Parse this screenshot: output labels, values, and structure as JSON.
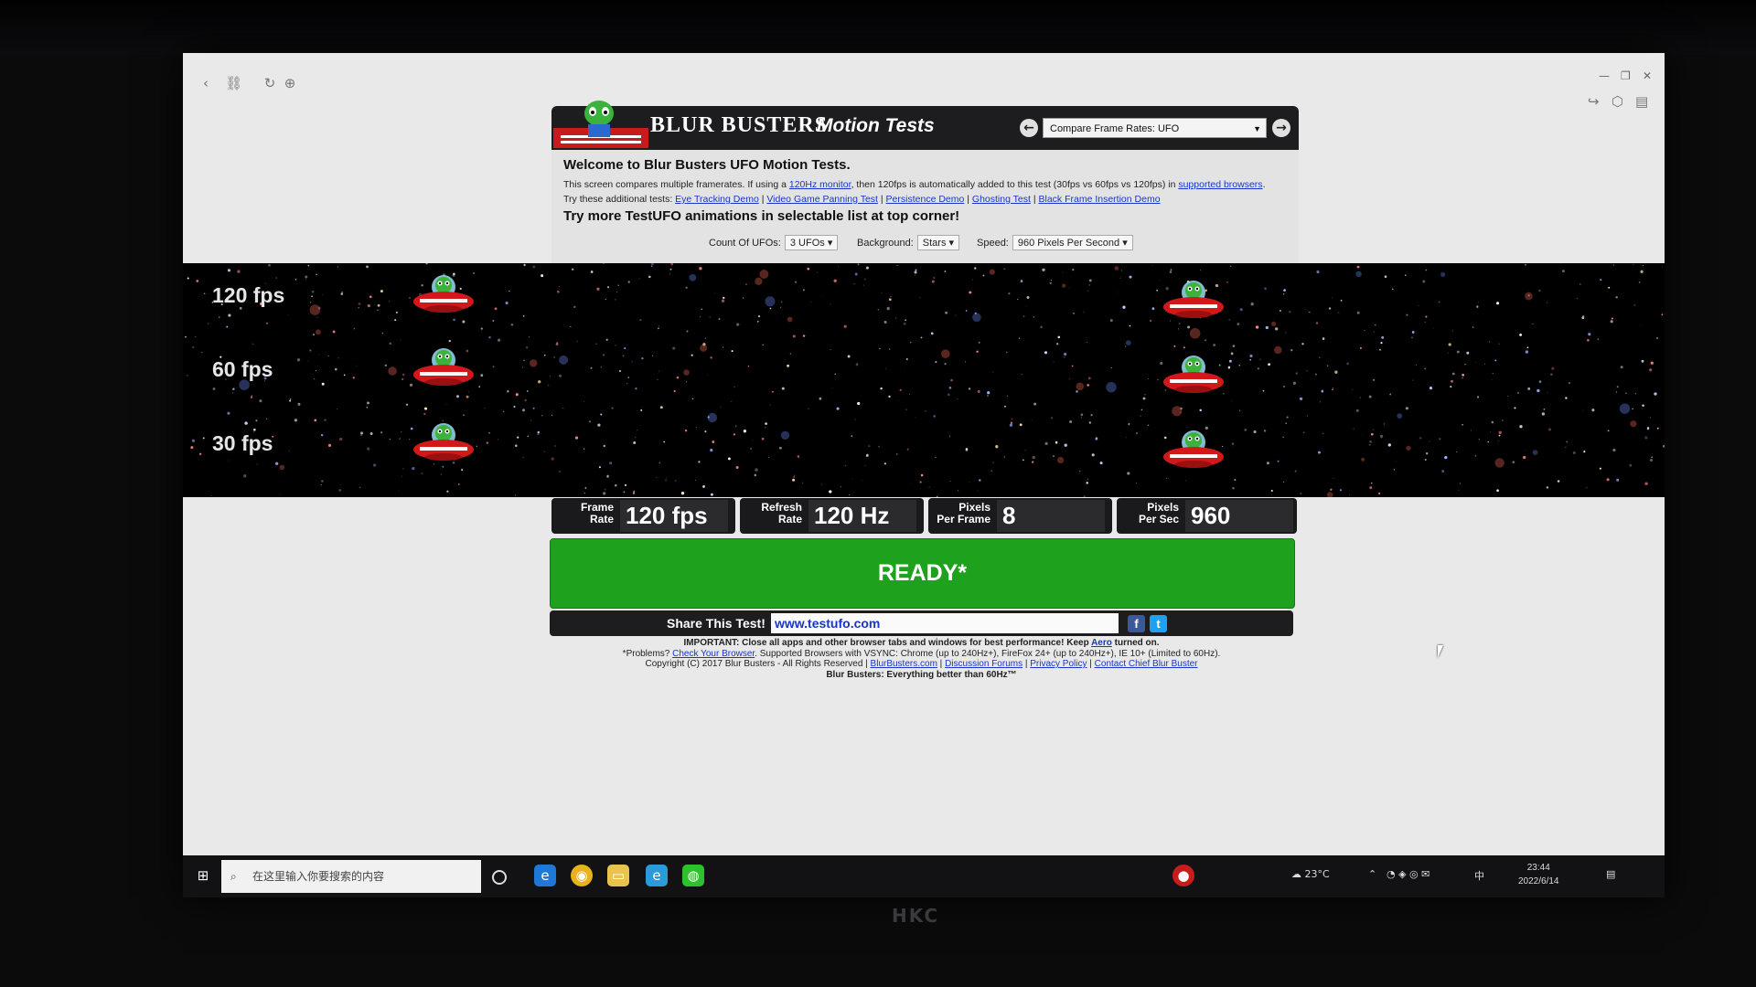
{
  "page": {
    "brand": "BLUR BUSTERS",
    "brand_sub": "Motion Tests",
    "test_select": "Compare Frame Rates: UFO",
    "welcome": "Welcome to Blur Busters UFO Motion Tests.",
    "intro": {
      "a": "This screen compares multiple framerates. If using a ",
      "link1": "120Hz monitor",
      "b": ", then 120fps is automatically added to this test (30fps vs 60fps vs 120fps) in ",
      "link2": "supported browsers",
      "c": "."
    },
    "additional": {
      "prefix": "Try these additional tests: ",
      "links": [
        "Eye Tracking Demo",
        "Video Game Panning Test",
        "Persistence Demo",
        "Ghosting Test",
        "Black Frame Insertion Demo"
      ]
    },
    "try_more": "Try more TestUFO animations in selectable list at top corner!",
    "settings": {
      "count_label": "Count Of UFOs:",
      "count_value": "3 UFOs",
      "background_label": "Background:",
      "background_value": "Stars",
      "speed_label": "Speed:",
      "speed_value": "960 Pixels Per Second"
    },
    "rows": [
      {
        "label": "120 fps"
      },
      {
        "label": "60 fps"
      },
      {
        "label": "30 fps"
      }
    ],
    "stats": [
      {
        "label1": "Frame",
        "label2": "Rate",
        "value": "120 fps"
      },
      {
        "label1": "Refresh",
        "label2": "Rate",
        "value": "120 Hz"
      },
      {
        "label1": "Pixels",
        "label2": "Per Frame",
        "value": "8"
      },
      {
        "label1": "Pixels",
        "label2": "Per Sec",
        "value": "960"
      }
    ],
    "ready": "READY*",
    "share": {
      "label": "Share This Test!",
      "url": "www.testufo.com"
    },
    "footer": {
      "line1a": "IMPORTANT: Close all apps and other browser tabs and windows for best performance! Keep ",
      "line1_link": "Aero",
      "line1b": " turned on.",
      "line2a": "*Problems? ",
      "line2_link": "Check Your Browser",
      "line2b": ". Supported Browsers with VSYNC: Chrome (up to 240Hz+), FireFox 24+ (up to 240Hz+), IE 10+ (Limited to 60Hz).",
      "line3a": "Copyright (C) 2017 Blur Busters - All Rights Reserved | ",
      "links3": [
        "BlurBusters.com",
        "Discussion Forums",
        "Privacy Policy",
        "Contact Chief Blur Buster"
      ],
      "line4": "Blur Busters: Everything better than 60Hz™"
    }
  },
  "taskbar": {
    "search_placeholder": "在这里输入你要搜索的内容",
    "weather": "23°C",
    "ime": "中",
    "time": "23:44",
    "date": "2022/6/14"
  },
  "monitor_brand": "HKC"
}
